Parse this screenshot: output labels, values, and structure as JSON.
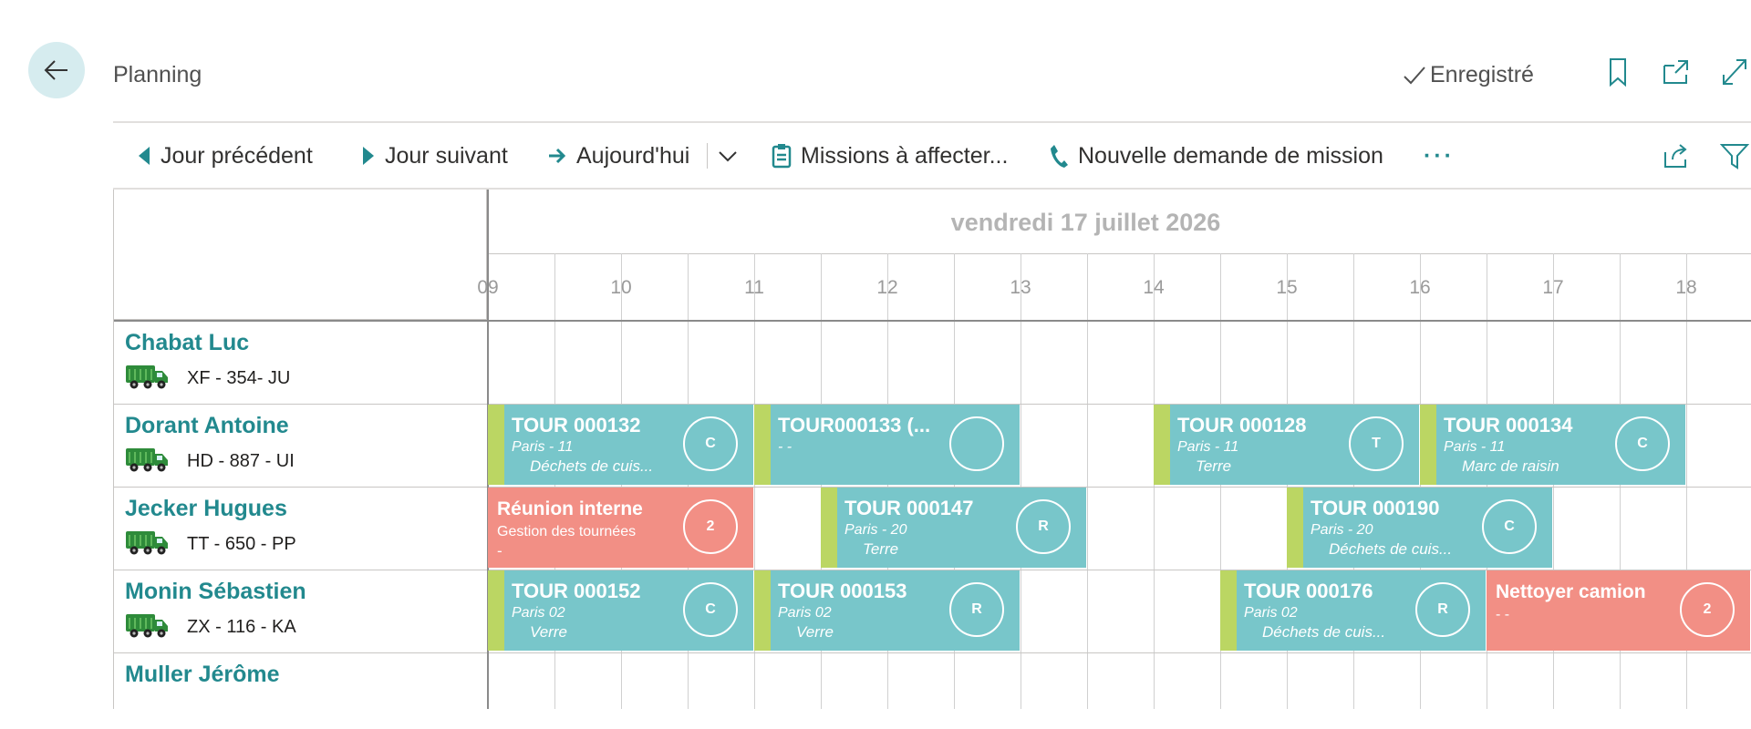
{
  "header": {
    "title": "Planning",
    "saved_label": "Enregistré"
  },
  "icons": {
    "back": "arrow-left-icon",
    "saved": "checkmark-icon",
    "bookmark": "bookmark-icon",
    "open_new": "open-in-new-icon",
    "expand": "expand-icon",
    "share": "share-icon",
    "filter": "filter-icon"
  },
  "toolbar": {
    "prev_day": "Jour précédent",
    "next_day": "Jour suivant",
    "today": "Aujourd'hui",
    "missions": "Missions à affecter...",
    "new_request": "Nouvelle demande de mission",
    "more": "···"
  },
  "colors": {
    "accent": "#22898e",
    "tour": "#78c6ca",
    "tour_stripe": "#bbd663",
    "meeting": "#f28f85"
  },
  "schedule": {
    "date": "vendredi 17 juillet 2026",
    "hours": [
      "09",
      "10",
      "11",
      "12",
      "13",
      "14",
      "15",
      "16",
      "17",
      "18"
    ]
  },
  "resources": [
    {
      "name": "Chabat Luc",
      "plate": "XF - 354- JU"
    },
    {
      "name": "Dorant Antoine",
      "plate": "HD - 887 - UI"
    },
    {
      "name": "Jecker Hugues",
      "plate": "TT - 650 - PP"
    },
    {
      "name": "Monin Sébastien",
      "plate": "ZX - 116 - KA"
    },
    {
      "name": "Muller Jérôme",
      "plate": ""
    }
  ],
  "events": [
    {
      "row": 1,
      "start": 9.0,
      "end": 11.0,
      "kind": "tour",
      "title": "TOUR 000132",
      "sub": "Paris - 11",
      "detail": "Déchets de cuis...",
      "badge": "C"
    },
    {
      "row": 1,
      "start": 11.0,
      "end": 13.0,
      "kind": "tour",
      "title": "TOUR000133 (...",
      "sub": "-  -",
      "detail": "",
      "badge": ""
    },
    {
      "row": 1,
      "start": 14.0,
      "end": 16.0,
      "kind": "tour",
      "title": "TOUR 000128",
      "sub": "Paris - 11",
      "detail": "Terre",
      "badge": "T"
    },
    {
      "row": 1,
      "start": 16.0,
      "end": 18.0,
      "kind": "tour",
      "title": "TOUR 000134",
      "sub": "Paris - 11",
      "detail": "Marc de raisin",
      "badge": "C"
    },
    {
      "row": 2,
      "start": 9.0,
      "end": 11.0,
      "kind": "meeting",
      "title": "Réunion interne",
      "sub": "Gestion des tournées",
      "detail": "-",
      "badge": "2"
    },
    {
      "row": 2,
      "start": 11.5,
      "end": 13.5,
      "kind": "tour",
      "title": "TOUR 000147",
      "sub": "Paris - 20",
      "detail": "Terre",
      "badge": "R"
    },
    {
      "row": 2,
      "start": 15.0,
      "end": 17.0,
      "kind": "tour",
      "title": "TOUR 000190",
      "sub": "Paris - 20",
      "detail": "Déchets de cuis...",
      "badge": "C"
    },
    {
      "row": 3,
      "start": 9.0,
      "end": 11.0,
      "kind": "tour",
      "title": "TOUR 000152",
      "sub": "Paris 02",
      "detail": "Verre",
      "badge": "C"
    },
    {
      "row": 3,
      "start": 11.0,
      "end": 13.0,
      "kind": "tour",
      "title": "TOUR 000153",
      "sub": "Paris 02",
      "detail": "Verre",
      "badge": "R"
    },
    {
      "row": 3,
      "start": 14.5,
      "end": 16.5,
      "kind": "tour",
      "title": "TOUR 000176",
      "sub": "Paris 02",
      "detail": "Déchets de cuis...",
      "badge": "R"
    },
    {
      "row": 3,
      "start": 16.5,
      "end": 18.5,
      "kind": "meeting",
      "title": "Nettoyer camion",
      "sub": "-  -",
      "detail": "",
      "badge": "2"
    }
  ]
}
